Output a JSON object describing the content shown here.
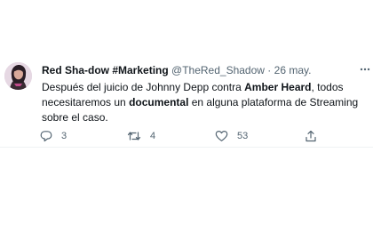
{
  "tweet": {
    "display_name": "Red Sha-dow #Marketing",
    "handle": "@TheRed_Shadow",
    "separator": "·",
    "date": "26 may.",
    "text_part1": "Después del juicio de Johnny Depp contra ",
    "text_bold1": "Amber Heard",
    "text_part2": ", todos necesitaremos un ",
    "text_bold2": "documental",
    "text_part3": " en alguna plataforma de Streaming sobre el caso.",
    "more_icon": "more-dots-icon"
  },
  "actions": {
    "reply_count": "3",
    "retweet_count": "4",
    "like_count": "53",
    "share_icon": "share-icon"
  },
  "colors": {
    "text": "#0f1419",
    "secondary": "#536471",
    "avatar_bg": "#d8c8d6",
    "divider": "#eff3f4"
  }
}
